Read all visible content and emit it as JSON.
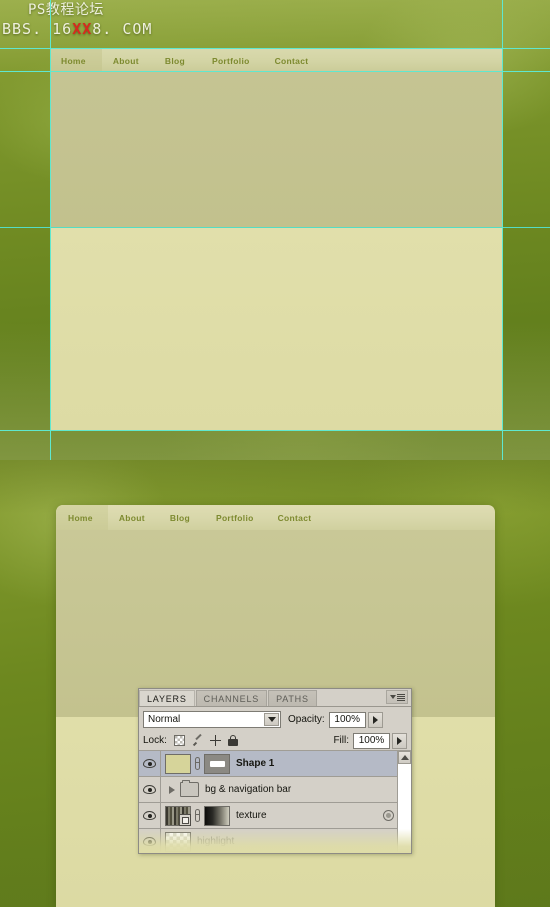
{
  "watermark": {
    "line1": "PS教程论坛",
    "line2_pre": "BBS. 16",
    "line2_hl": "XX",
    "line2_post": "8. COM"
  },
  "site_mockup": {
    "nav": [
      {
        "label": "Home",
        "active": true
      },
      {
        "label": "About",
        "active": false
      },
      {
        "label": "Blog",
        "active": false
      },
      {
        "label": "Portfolio",
        "active": false
      },
      {
        "label": "Contact",
        "active": false
      }
    ],
    "colors": {
      "nav_bar": "#d8d7aa",
      "nav_active": "#cfcf9d",
      "band_upper": "#c3c28e",
      "band_lower": "#dedca7",
      "nav_text": "#7d8a2f",
      "background_green": "#6d881f",
      "guide_cyan": "#5fe8cf"
    }
  },
  "layers_panel": {
    "tabs": [
      {
        "label": "LAYERS",
        "active": true
      },
      {
        "label": "CHANNELS",
        "active": false
      },
      {
        "label": "PATHS",
        "active": false
      }
    ],
    "panel_menu_icon": "panel-menu-icon",
    "blend_mode": "Normal",
    "opacity_label": "Opacity:",
    "opacity_value": "100%",
    "fill_label": "Fill:",
    "fill_value": "100%",
    "lock_label": "Lock:",
    "lock_icons": [
      "lock-transparent-pixels-icon",
      "lock-image-pixels-icon",
      "lock-position-icon",
      "lock-all-icon"
    ],
    "layers": [
      {
        "name": "Shape 1",
        "visible": true,
        "selected": true,
        "bold": true,
        "dim": false,
        "thumb": "solid-fill",
        "linked": true,
        "mask": "vector-mask",
        "has_fx": false,
        "is_group": false
      },
      {
        "name": "bg & navigation bar",
        "visible": true,
        "selected": false,
        "bold": false,
        "dim": false,
        "thumb": "folder",
        "linked": false,
        "mask": null,
        "has_fx": false,
        "is_group": true
      },
      {
        "name": "texture",
        "visible": true,
        "selected": false,
        "bold": false,
        "dim": false,
        "thumb": "texture-clipped",
        "linked": true,
        "mask": "gradient-mask",
        "has_fx": true,
        "is_group": false
      },
      {
        "name": "highlight",
        "visible": true,
        "selected": false,
        "bold": false,
        "dim": true,
        "thumb": "transparent",
        "linked": false,
        "mask": null,
        "has_fx": false,
        "is_group": false
      }
    ],
    "scrollbar": {
      "up_arrow": "scroll-up-icon"
    }
  }
}
